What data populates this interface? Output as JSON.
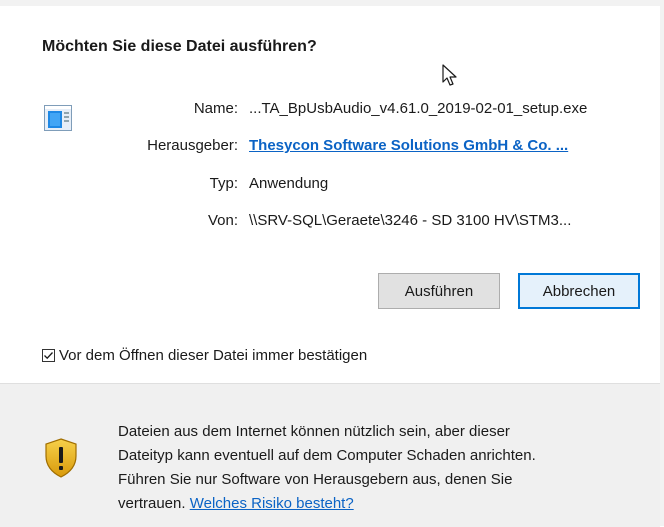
{
  "dialog": {
    "title": "Möchten Sie diese Datei ausführen?"
  },
  "fields": {
    "name_label": "Name:",
    "name_value": "...TA_BpUsbAudio_v4.61.0_2019-02-01_setup.exe",
    "publisher_label": "Herausgeber:",
    "publisher_value": "Thesycon Software Solutions GmbH & Co. ...",
    "type_label": "Typ:",
    "type_value": "Anwendung",
    "from_label": "Von:",
    "from_value": "\\\\SRV-SQL\\Geraete\\3246 - SD 3100 HV\\STM3..."
  },
  "buttons": {
    "run_label": "Ausführen",
    "cancel_label": "Abbrechen"
  },
  "checkbox": {
    "label": "Vor dem Öffnen dieser Datei immer bestätigen",
    "checked": true
  },
  "warning": {
    "line1": "Dateien aus dem Internet können nützlich sein, aber dieser",
    "line2": "Dateityp kann eventuell auf dem Computer Schaden anrichten.",
    "line3": "Führen Sie nur Software von Herausgebern aus, denen Sie",
    "line4_prefix": "vertrauen.",
    "link": "Welches Risiko besteht?"
  },
  "icons": {
    "file": "application-window-icon",
    "shield": "warning-shield-icon",
    "cursor": "mouse-pointer-icon"
  },
  "colors": {
    "link": "#0b63c5",
    "focus_border": "#0078d7",
    "shield_gold": "#e8b31c"
  }
}
